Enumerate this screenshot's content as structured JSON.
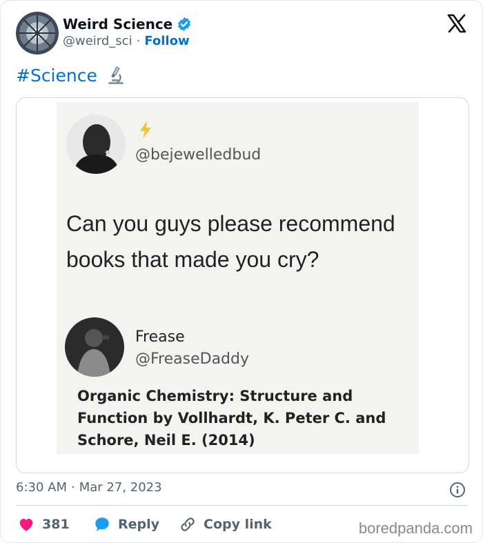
{
  "author": {
    "name": "Weird Science",
    "handle": "@weird_sci",
    "separator": "·",
    "follow_label": "Follow"
  },
  "tweet": {
    "text": "#Science",
    "emoji_icon": "microscope-icon"
  },
  "embedded_image": {
    "question_handle": "@bejewelledbud",
    "question_text": "Can you guys please recommend books that made you cry?",
    "reply_name": "Frease",
    "reply_handle": "@FreaseDaddy",
    "reply_text": "Organic Chemistry: Structure and Function by Vollhardt, K. Peter C. and Schore, Neil E. (2014)"
  },
  "meta": {
    "time": "6:30 AM",
    "separator": "·",
    "date": "Mar 27, 2023"
  },
  "actions": {
    "like_count": "381",
    "reply_label": "Reply",
    "copy_label": "Copy link"
  },
  "watermark": "boredpanda.com",
  "colors": {
    "link": "#006fd6",
    "like": "#f91880",
    "reply": "#1d9bf0",
    "muted": "#536471"
  }
}
